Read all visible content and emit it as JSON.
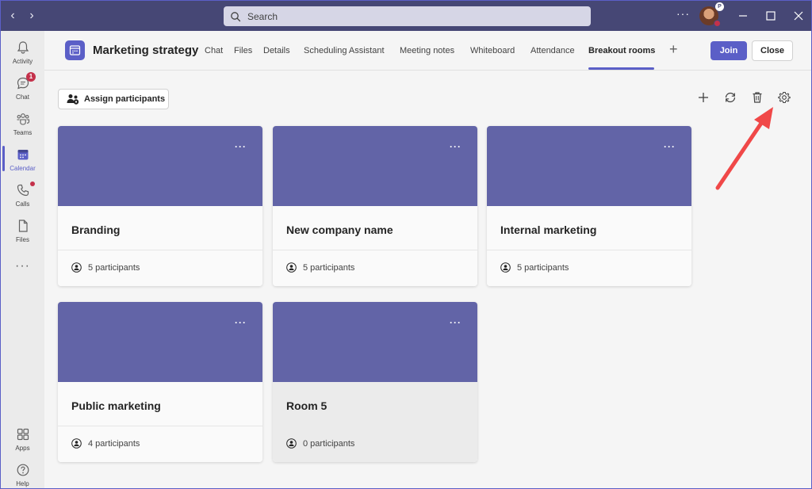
{
  "titlebar": {
    "search_placeholder": "Search",
    "more_label": "···",
    "avatar_badge": "P"
  },
  "rail": {
    "items": [
      {
        "label": "Activity",
        "icon": "bell-icon"
      },
      {
        "label": "Chat",
        "icon": "chat-icon",
        "badge": "1"
      },
      {
        "label": "Teams",
        "icon": "teams-icon"
      },
      {
        "label": "Calendar",
        "icon": "calendar-icon",
        "active": true
      },
      {
        "label": "Calls",
        "icon": "phone-icon"
      },
      {
        "label": "Files",
        "icon": "file-icon"
      },
      {
        "label": "Apps",
        "icon": "apps-icon"
      },
      {
        "label": "Help",
        "icon": "help-icon"
      }
    ],
    "more_label": "···"
  },
  "header": {
    "title": "Marketing strategy",
    "tabs": [
      {
        "label": "Chat"
      },
      {
        "label": "Files"
      },
      {
        "label": "Details"
      },
      {
        "label": "Scheduling Assistant"
      },
      {
        "label": "Meeting notes"
      },
      {
        "label": "Whiteboard"
      },
      {
        "label": "Attendance"
      },
      {
        "label": "Breakout rooms",
        "active": true
      }
    ],
    "add_tab_label": "+",
    "join_label": "Join",
    "close_label": "Close"
  },
  "toolbar": {
    "assign_label": "Assign participants",
    "icons": [
      "add-icon",
      "refresh-icon",
      "delete-icon",
      "settings-icon"
    ]
  },
  "rooms": [
    {
      "name": "Branding",
      "count": "5 participants"
    },
    {
      "name": "New company name",
      "count": "5 participants"
    },
    {
      "name": "Internal marketing",
      "count": "5 participants"
    },
    {
      "name": "Public marketing",
      "count": "4 participants"
    },
    {
      "name": "Room 5",
      "count": "0 participants"
    }
  ],
  "colors": {
    "brand": "#5b5fc7",
    "titlebar": "#464775",
    "card_banner": "#6264a7",
    "annotation_arrow": "#f04848",
    "badge": "#c4314b"
  }
}
